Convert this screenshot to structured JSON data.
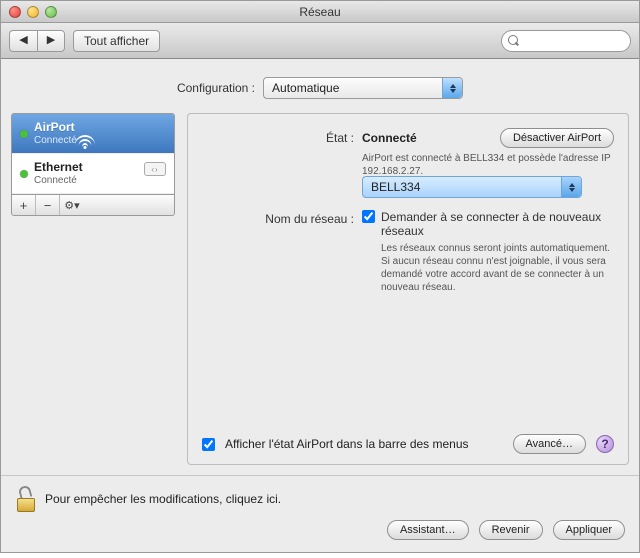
{
  "window": {
    "title": "Réseau"
  },
  "toolbar": {
    "show_all": "Tout afficher",
    "search_placeholder": ""
  },
  "config": {
    "label": "Configuration :",
    "value": "Automatique"
  },
  "sidebar": {
    "items": [
      {
        "title": "AirPort",
        "sub": "Connecté",
        "selected": true,
        "icon": "wifi"
      },
      {
        "title": "Ethernet",
        "sub": "Connecté",
        "selected": false,
        "icon": "ethernet"
      }
    ],
    "add": "+",
    "remove": "−",
    "gear": "✻▾"
  },
  "detail": {
    "state_label": "État :",
    "state_value": "Connecté",
    "deactivate_btn": "Désactiver AirPort",
    "state_desc": "AirPort est connecté à BELL334 et possède l'adresse IP 192.168.2.27.",
    "network_label": "Nom du réseau :",
    "network_value": "BELL334",
    "ask_join_label": "Demander à se connecter à de nouveaux réseaux",
    "ask_join_desc": "Les réseaux connus seront joints automatiquement. Si aucun réseau connu n'est joignable, il vous sera demandé votre accord avant de se connecter à un nouveau réseau.",
    "show_menu_label": "Afficher l'état AirPort dans la barre des menus",
    "advanced_btn": "Avancé…",
    "help": "?"
  },
  "footer": {
    "lock_text": "Pour empêcher les modifications, cliquez ici.",
    "assistant": "Assistant…",
    "revert": "Revenir",
    "apply": "Appliquer"
  }
}
